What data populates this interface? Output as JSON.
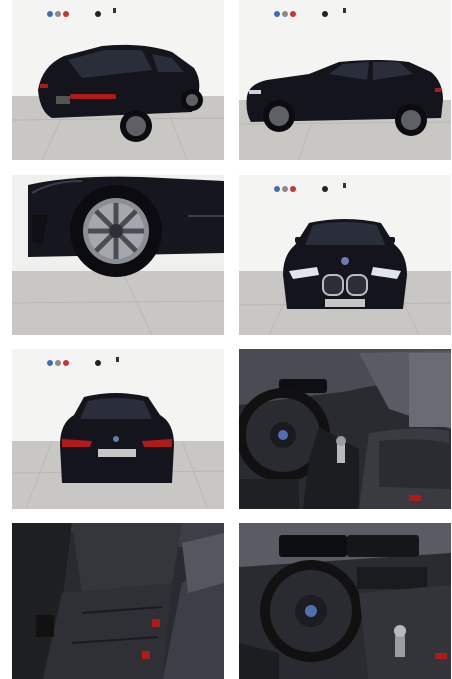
{
  "gallery": {
    "photos": [
      {
        "view": "rear-three-quarter",
        "showroom": true
      },
      {
        "view": "side-profile",
        "showroom": true
      },
      {
        "view": "front-wheel-closeup",
        "showroom": true
      },
      {
        "view": "front",
        "showroom": true
      },
      {
        "view": "rear",
        "showroom": true
      },
      {
        "view": "interior-center-console",
        "showroom": false
      },
      {
        "view": "interior-rear-seats",
        "showroom": false
      },
      {
        "view": "interior-dashboard",
        "showroom": false
      }
    ],
    "colors": {
      "car_body": "#14141c",
      "floor": "#c9c7c4",
      "wall": "#f4f4f2",
      "taillight": "#b01a1a",
      "interior": "#2a2b30"
    }
  }
}
